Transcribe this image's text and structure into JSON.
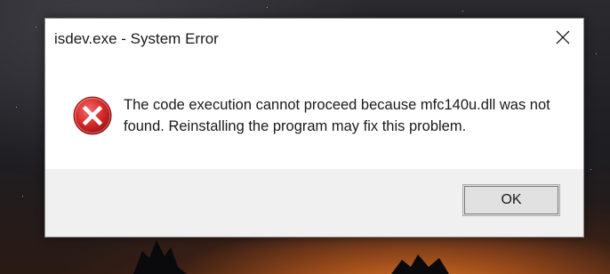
{
  "dialog": {
    "title": "isdev.exe - System Error",
    "message": "The code execution cannot proceed because mfc140u.dll was not found. Reinstalling the program may fix this problem.",
    "icon": "error-icon",
    "ok_label": "OK",
    "close_icon": "close-icon"
  },
  "colors": {
    "error_red": "#d42a2a",
    "button_bg": "#e1e1e1",
    "footer_bg": "#f0f0f0"
  }
}
